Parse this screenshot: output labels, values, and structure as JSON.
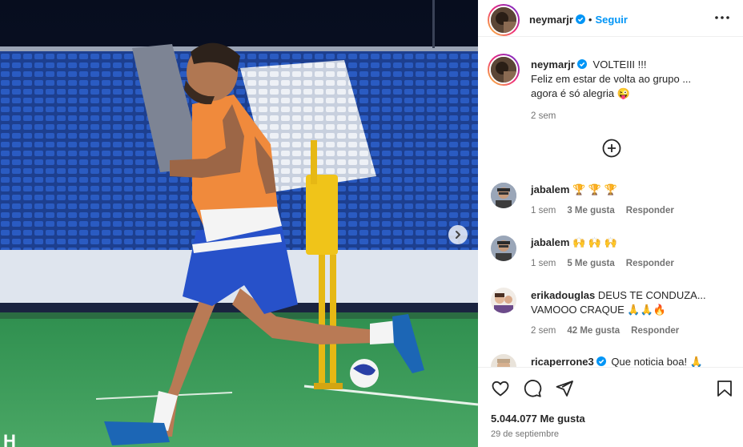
{
  "post": {
    "author": "neymarjr",
    "follow_label": "Seguir",
    "dot": "•",
    "caption_author": "neymarjr",
    "caption_lines": [
      "VOLTEIII !!!",
      "Feliz em estar de volta ao grupo ...",
      "agora é só alegria 😜"
    ],
    "caption_time": "2 sem",
    "likes": "5.044.077 Me gusta",
    "date": "29 de septiembre",
    "media_watermark": "H"
  },
  "comments": [
    {
      "user": "jabalem",
      "verified": false,
      "lines": [
        "🏆 🏆 🏆"
      ],
      "time": "1 sem",
      "likes": "3 Me gusta",
      "reply": "Responder"
    },
    {
      "user": "jabalem",
      "verified": false,
      "lines": [
        "🙌 🙌 🙌"
      ],
      "time": "1 sem",
      "likes": "5 Me gusta",
      "reply": "Responder"
    },
    {
      "user": "erikadouglas",
      "verified": false,
      "lines": [
        "DEUS TE CONDUZA...",
        "VAMOOO CRAQUE 🙏🙏🔥"
      ],
      "time": "2 sem",
      "likes": "42 Me gusta",
      "reply": "Responder"
    },
    {
      "user": "ricaperrone3",
      "verified": true,
      "lines": [
        "Que noticia boa! 🙏"
      ],
      "time": "",
      "likes": "",
      "reply": ""
    }
  ],
  "colors": {
    "accent": "#0095f6",
    "verified": "#0095f6",
    "text": "#262626",
    "muted": "#737373"
  },
  "icons": [
    "verified-badge-icon",
    "more-options-icon",
    "add-comment-icon",
    "heart-icon",
    "comment-icon",
    "share-icon",
    "bookmark-icon",
    "chevron-right-icon"
  ]
}
